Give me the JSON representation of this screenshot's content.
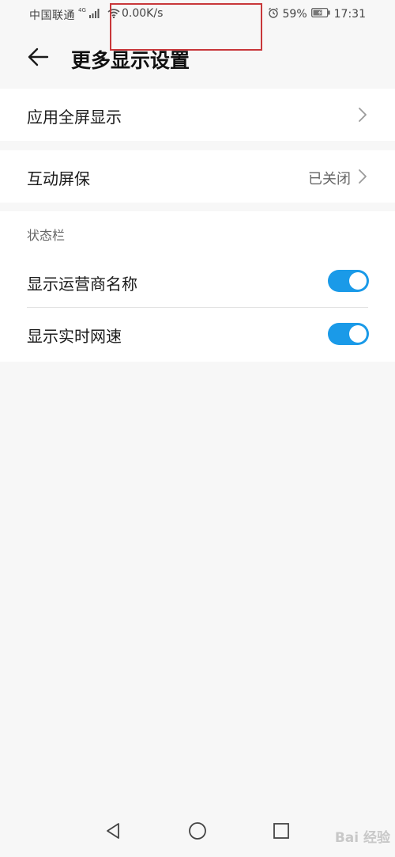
{
  "status_bar": {
    "carrier": "中国联通",
    "network_type": "4G",
    "network_speed": "0.00K/s",
    "battery": "59%",
    "time": "17:31",
    "icons": [
      "signal-icon",
      "wifi-icon",
      "alarm-icon",
      "battery-charging-icon"
    ]
  },
  "header": {
    "title": "更多显示设置",
    "back_icon": "arrow-left-icon"
  },
  "settings": {
    "fullscreen_display": {
      "label": "应用全屏显示"
    },
    "interactive_screensaver": {
      "label": "互动屏保",
      "value": "已关闭"
    },
    "status_bar_section": {
      "title": "状态栏",
      "items": [
        {
          "label": "显示运营商名称",
          "enabled": true
        },
        {
          "label": "显示实时网速",
          "enabled": true
        }
      ]
    }
  },
  "nav_bar": {
    "icons": [
      "back-triangle-icon",
      "home-circle-icon",
      "recents-square-icon"
    ]
  },
  "watermark": {
    "text": "Bai 经验"
  },
  "colors": {
    "toggle_on": "#1a9ae8",
    "highlight_box": "#c8373a",
    "background": "#f7f7f7"
  }
}
